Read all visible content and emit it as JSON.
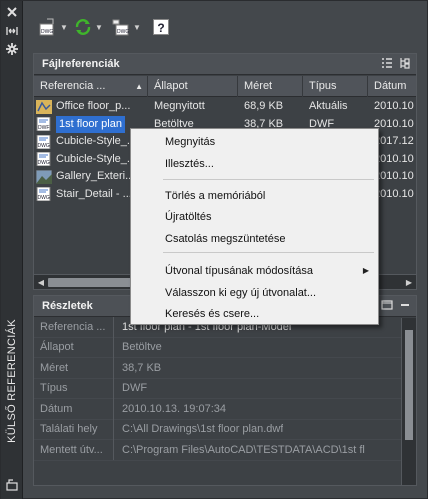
{
  "sidebar": {
    "close_icon": "close-icon",
    "autohide_icon": "autohide-icon",
    "settings_icon": "gear-icon",
    "title": "KÜLSŐ REFERENCIÁK"
  },
  "toolbar": {
    "attach_icon": "attach-dwg-icon",
    "refresh_icon": "refresh-icon",
    "change_path_icon": "change-path-icon",
    "help_icon": "help-icon",
    "help_glyph": "?"
  },
  "file_refs": {
    "title": "Fájlreferenciák",
    "columns": [
      "Referencia ...",
      "Állapot",
      "Méret",
      "Típus",
      "Dátum"
    ],
    "rows": [
      {
        "name": "Office floor_p...",
        "status": "Megnyitott",
        "size": "68,9 KB",
        "type": "Aktuális",
        "date": "2010.10",
        "icon": "dwg-drawing-icon"
      },
      {
        "name": "1st floor plan",
        "status": "Betöltve",
        "size": "38,7 KB",
        "type": "DWF",
        "date": "2010.10",
        "icon": "dwf-file-icon",
        "selected": true
      },
      {
        "name": "Cubicle-Style_...",
        "status": "",
        "size": "",
        "type": "",
        "date": "2017.12",
        "icon": "dwg-file-icon"
      },
      {
        "name": "Cubicle-Style_...",
        "status": "",
        "size": "",
        "type": "",
        "date": "2010.10",
        "icon": "dwg-file-icon"
      },
      {
        "name": "Gallery_Exteri...",
        "status": "",
        "size": "",
        "type": "",
        "date": "2010.10",
        "icon": "raster-image-icon"
      },
      {
        "name": "Stair_Detail - ...",
        "status": "",
        "size": "",
        "type": "",
        "date": "2010.10",
        "icon": "dwg-file-icon"
      }
    ]
  },
  "details": {
    "title": "Részletek",
    "rows": [
      {
        "key": "Referencia ...",
        "value": "1st floor plan - 1st floor plan-Model"
      },
      {
        "key": "Állapot",
        "value": "Betöltve"
      },
      {
        "key": "Méret",
        "value": "38,7 KB"
      },
      {
        "key": "Típus",
        "value": "DWF"
      },
      {
        "key": "Dátum",
        "value": "2010.10.13. 19:07:34"
      },
      {
        "key": "Találati hely",
        "value": "C:\\All Drawings\\1st floor plan.dwf"
      },
      {
        "key": "Mentett útv...",
        "value": "C:\\Program Files\\AutoCAD\\TESTDATA\\ACD\\1st fl"
      }
    ]
  },
  "context_menu": {
    "items": [
      {
        "label": "Megnyitás"
      },
      {
        "label": "Illesztés..."
      },
      {
        "label": "Törlés a memóriából"
      },
      {
        "label": "Újratöltés"
      },
      {
        "label": "Csatolás megszüntetése"
      },
      {
        "label": "Útvonal típusának módosítása",
        "submenu": true
      },
      {
        "label": "Válasszon ki egy új útvonalat..."
      },
      {
        "label": "Keresés és csere..."
      }
    ]
  }
}
